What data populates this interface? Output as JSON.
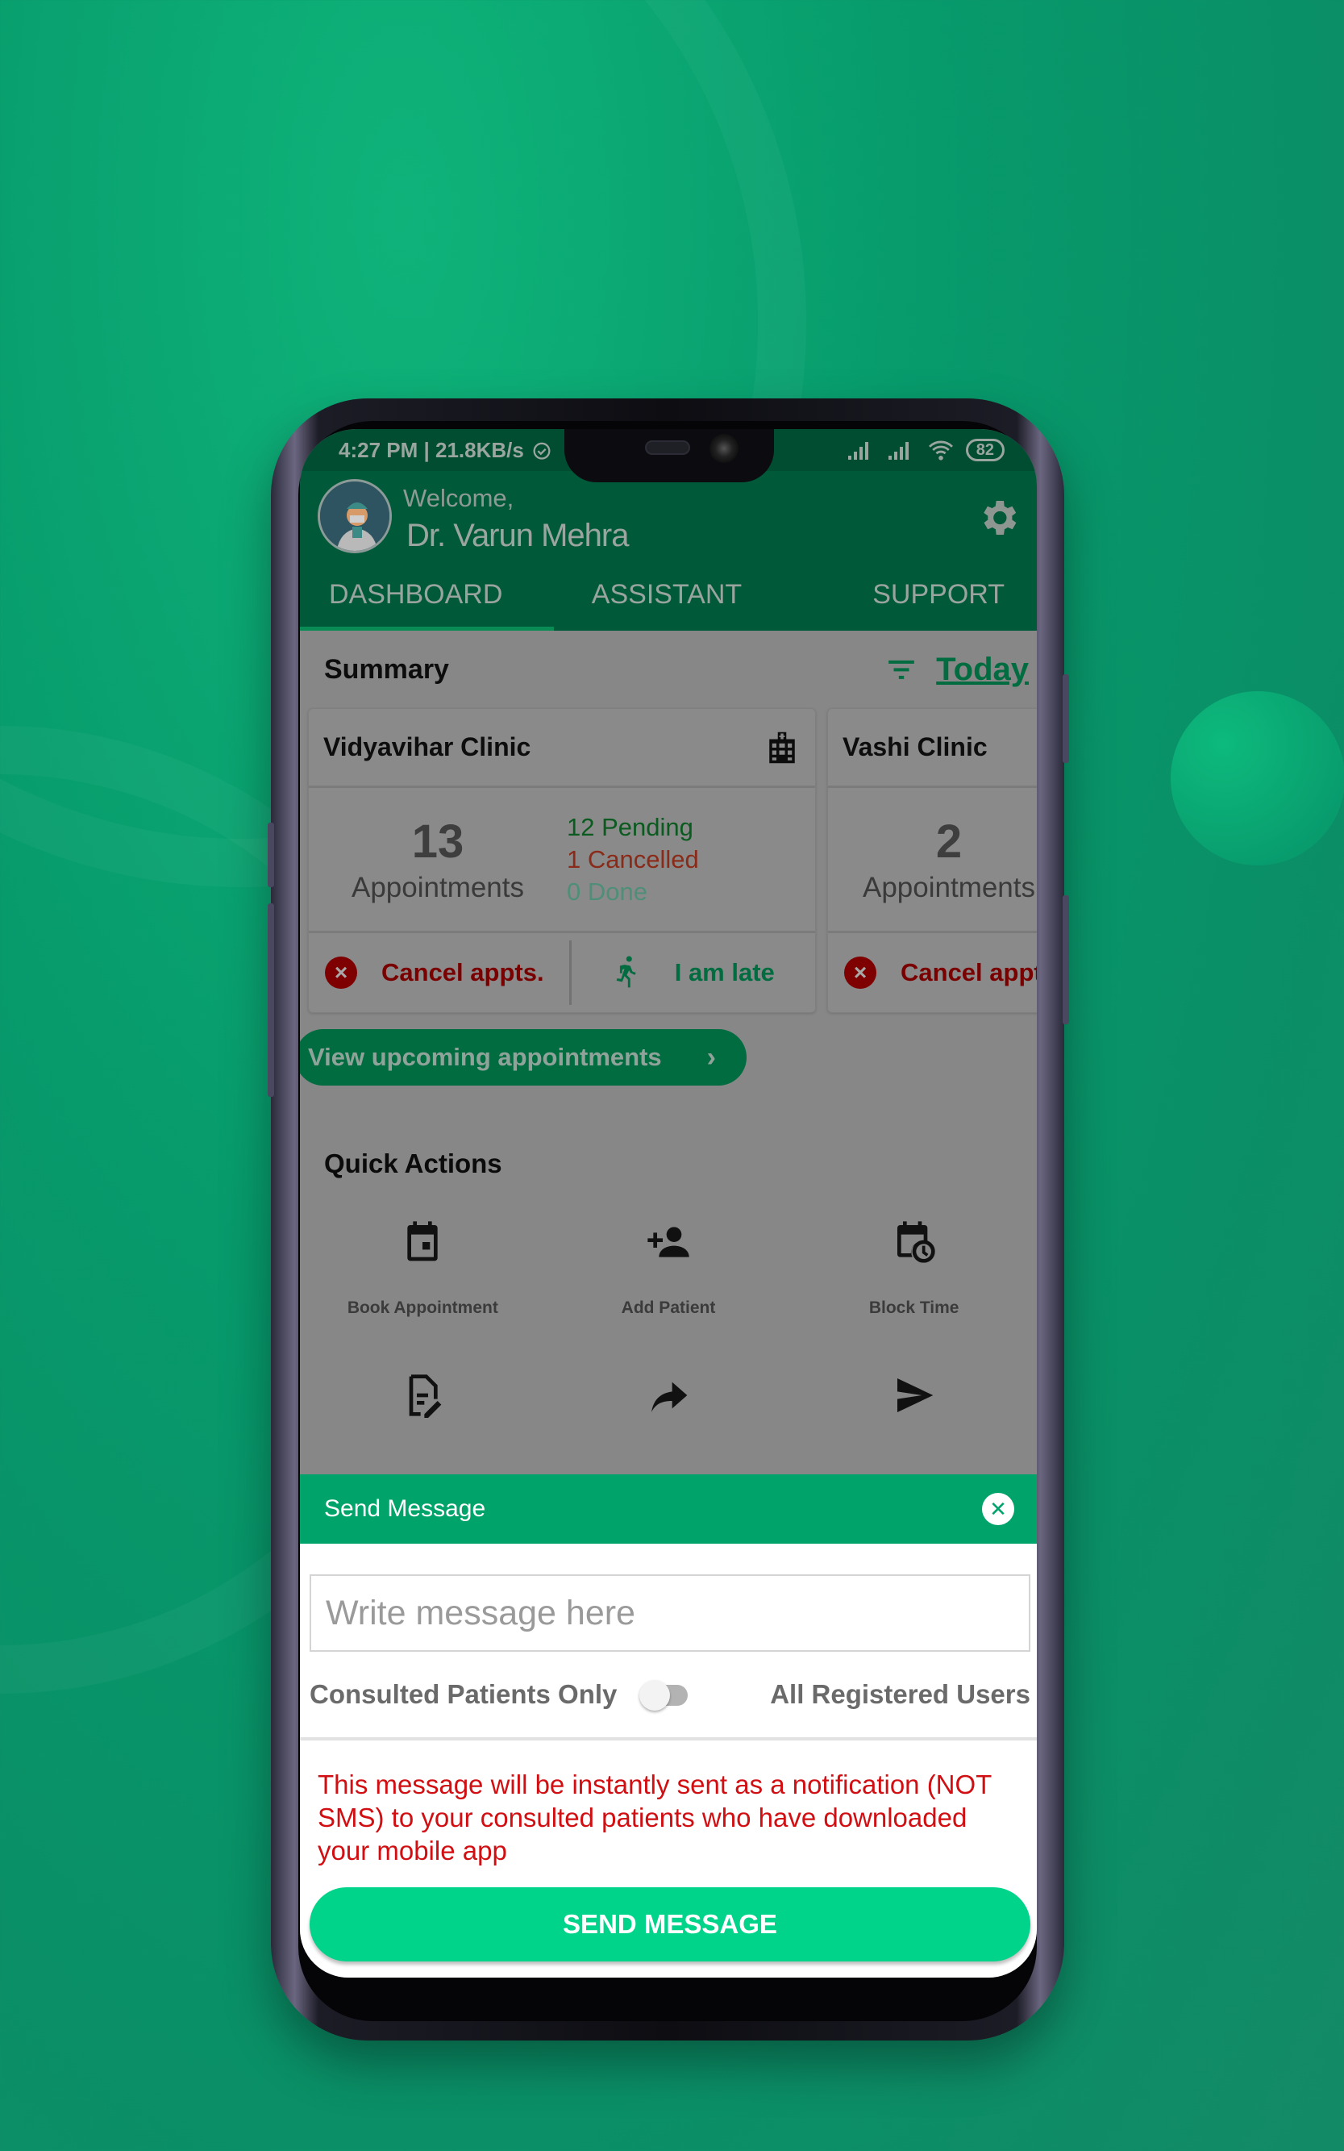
{
  "status_bar": {
    "time_speed": "4:27 PM | 21.8KB/s",
    "battery": "82"
  },
  "header": {
    "welcome": "Welcome,",
    "doctor_name": "Dr. Varun Mehra"
  },
  "tabs": [
    {
      "label": "DASHBOARD",
      "active": true
    },
    {
      "label": "ASSISTANT",
      "active": false
    },
    {
      "label": "SUPPORT",
      "active": false
    }
  ],
  "summary": {
    "title": "Summary",
    "filter_label": "Today"
  },
  "clinics": [
    {
      "name": "Vidyavihar Clinic",
      "count": "13",
      "count_label": "Appointments",
      "pending": "12 Pending",
      "cancelled": "1 Cancelled",
      "done": "0 Done",
      "cancel_action": "Cancel appts.",
      "late_action": "I am late"
    },
    {
      "name": "Vashi Clinic",
      "count": "2",
      "count_label": "Appointments",
      "cancel_action": "Cancel appts."
    }
  ],
  "view_upcoming": "View upcoming appointments",
  "quick_actions": {
    "title": "Quick Actions",
    "items": [
      {
        "label": "Book Appointment",
        "icon": "calendar-icon"
      },
      {
        "label": "Add Patient",
        "icon": "add-person-icon"
      },
      {
        "label": "Block Time",
        "icon": "calendar-clock-icon"
      },
      {
        "label": "",
        "icon": "edit-document-icon"
      },
      {
        "label": "",
        "icon": "share-arrow-icon"
      },
      {
        "label": "",
        "icon": "send-icon"
      }
    ]
  },
  "send_message": {
    "title": "Send Message",
    "placeholder": "Write message here",
    "option_left": "Consulted Patients Only",
    "option_right": "All Registered Users",
    "toggle_on": false,
    "notice": "This message will be instantly sent as a notification (NOT SMS) to your consulted patients who have downloaded your mobile app",
    "button": "SEND MESSAGE"
  },
  "colors": {
    "brand_green": "#00a46b",
    "send_button": "#00d48a",
    "warning_red": "#d10f12"
  }
}
